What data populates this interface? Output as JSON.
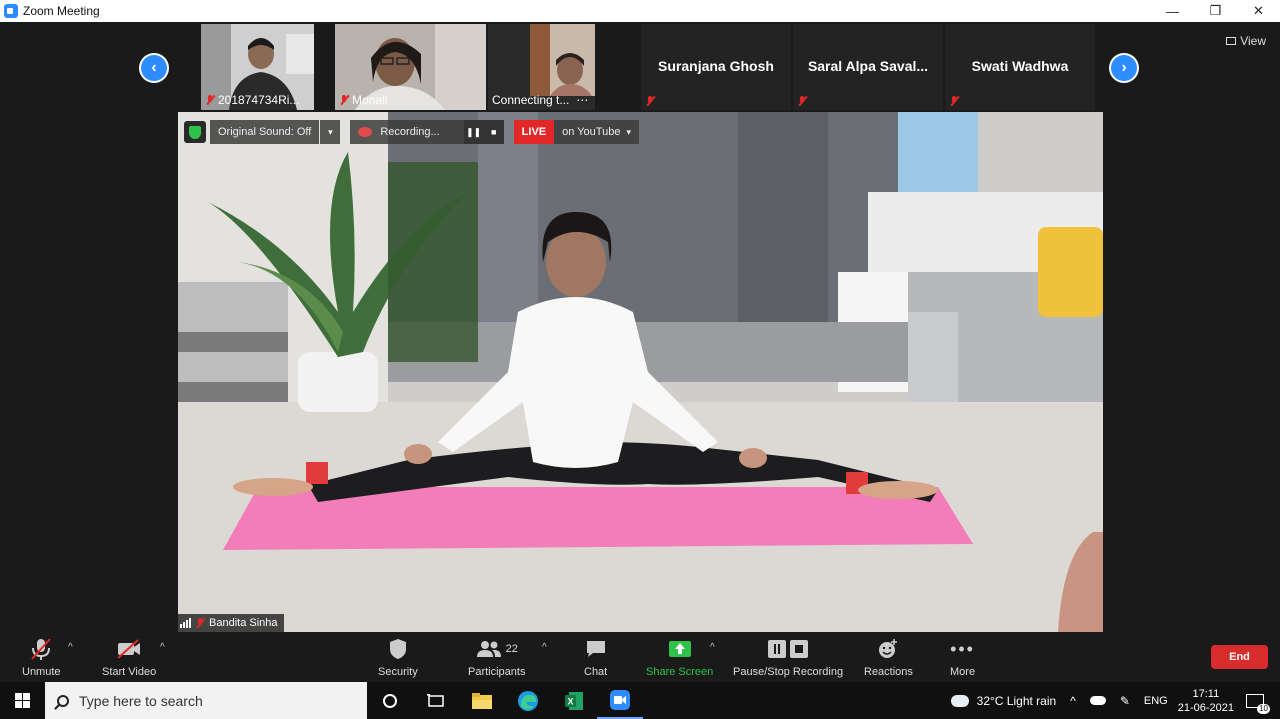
{
  "window": {
    "title": "Zoom Meeting",
    "controls": {
      "minimize": "—",
      "restore": "❐",
      "close": "✕"
    }
  },
  "gallery": {
    "prev_icon": "chevron-left-icon",
    "next_icon": "chevron-right-icon",
    "view_label": "View",
    "participants": [
      {
        "name": "201874734Ri...",
        "muted": true,
        "video": true
      },
      {
        "name": "Monali",
        "muted": true,
        "video": true
      },
      {
        "name": "Connecting t...",
        "muted": false,
        "video": true
      },
      {
        "name": "Suranjana Ghosh",
        "muted": true,
        "video": false
      },
      {
        "name": "Saral  Alpa  Saval...",
        "muted": true,
        "video": false
      },
      {
        "name": "Swati Wadhwa",
        "muted": true,
        "video": false
      }
    ]
  },
  "main_video": {
    "speaker_name": "Bandita Sinha",
    "original_sound": "Original Sound: Off",
    "recording_label": "Recording...",
    "live_label": "LIVE",
    "stream_target": "on YouTube"
  },
  "toolbar": {
    "unmute": "Unmute",
    "start_video": "Start Video",
    "security": "Security",
    "participants_count": "22",
    "participants": "Participants",
    "chat": "Chat",
    "share_screen": "Share Screen",
    "pause_stop_recording": "Pause/Stop Recording",
    "reactions": "Reactions",
    "more": "More",
    "end": "End"
  },
  "taskbar": {
    "search_placeholder": "Type here to search",
    "weather": "32°C  Light rain",
    "language": "ENG",
    "time": "17:11",
    "date": "21-06-2021",
    "notifications": "10"
  },
  "colors": {
    "zoom_blue": "#2d8cff",
    "live_red": "#e02828",
    "share_green": "#2ec24a",
    "end_red": "#d92c2c"
  }
}
